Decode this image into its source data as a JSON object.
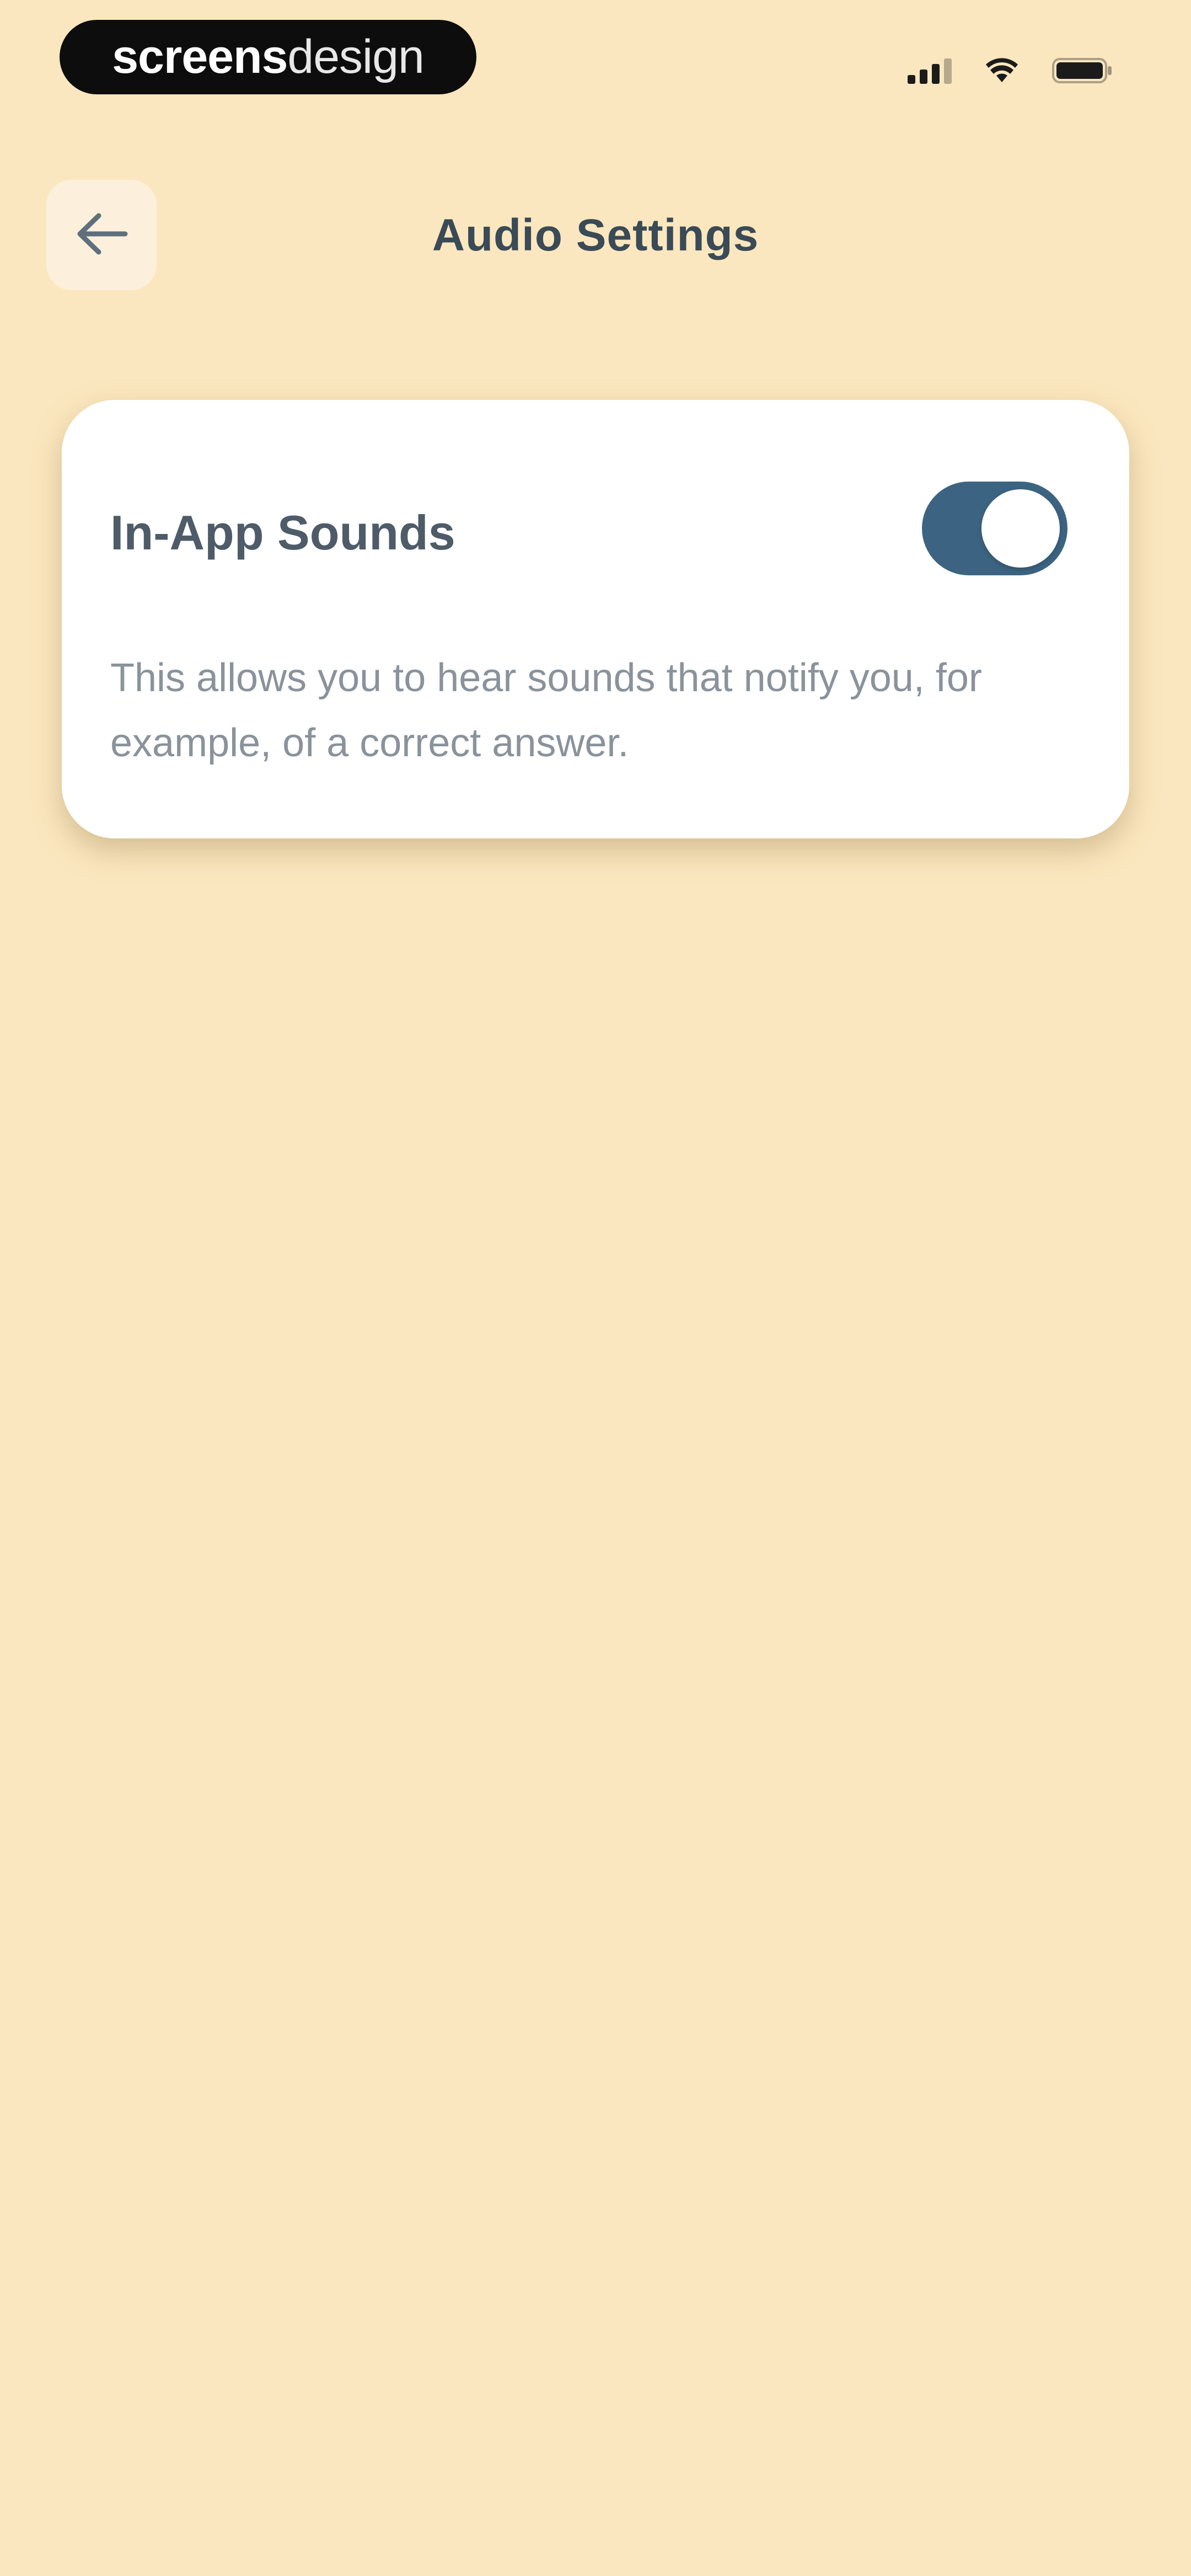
{
  "status_bar": {
    "watermark_part1": "screens",
    "watermark_part2": "design",
    "icons": [
      "signal-icon",
      "wifi-icon",
      "battery-icon"
    ]
  },
  "header": {
    "title": "Audio Settings",
    "back_icon": "arrow-left-icon"
  },
  "settings": {
    "in_app_sounds": {
      "label": "In-App Sounds",
      "enabled": true,
      "description": "This allows you to hear sounds that notify you, for example, of a correct answer."
    }
  },
  "colors": {
    "background": "#fbe7bf",
    "toggle_on": "#3c6482",
    "title_text": "#3a4a56",
    "description_text": "#8a929b"
  }
}
